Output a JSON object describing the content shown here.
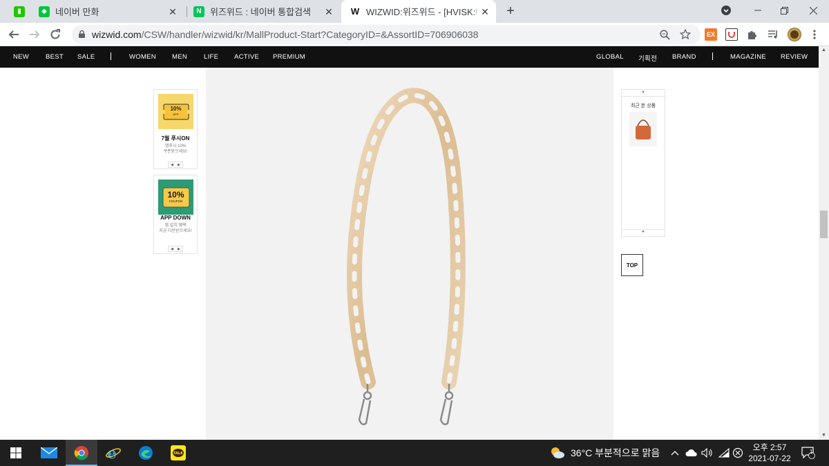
{
  "browser": {
    "tabs": [
      {
        "title": "",
        "favicon": "naver-green-icon",
        "pinned": true
      },
      {
        "title": "네이버 만화",
        "favicon": "naver-webtoon-icon"
      },
      {
        "title": "위즈위드 : 네이버 통합검색",
        "favicon": "naver-n-icon"
      },
      {
        "title": "WIZWID:위즈위드 - [HVISK:비스",
        "favicon": "wizwid-w-icon",
        "active": true
      }
    ],
    "new_tab": "+",
    "url_host": "wizwid.com",
    "url_path": "/CSW/handler/wizwid/kr/MallProduct-Start?CategoryID=&AssortID=706906038",
    "extensions": [
      "EX"
    ]
  },
  "site_nav": {
    "left": [
      "NEW",
      "BEST",
      "SALE",
      "|",
      "WOMEN",
      "MEN",
      "LIFE",
      "ACTIVE",
      "PREMIUM"
    ],
    "right": [
      "GLOBAL",
      "기획전",
      "BRAND",
      "|",
      "MAGAZINE",
      "REVIEW"
    ]
  },
  "promos": [
    {
      "badge_main": "10%",
      "badge_sub": "APP",
      "title": "7월 푸시ON",
      "sub1": "앱푸시 10%",
      "sub2": "쿠폰받으세요!",
      "color": "#f6d76b"
    },
    {
      "badge_main": "10%",
      "badge_sub": "COUPON",
      "title": "APP DOWN",
      "sub1": "앱 설치 혜택",
      "sub2": "지금 다운받으세요!",
      "color": "#2f9a76"
    }
  ],
  "recent": {
    "title": "최근 본 상품"
  },
  "top_button": "TOP",
  "taskbar": {
    "weather": "36°C  부분적으로 맑음",
    "time": "오후 2:57",
    "date": "2021-07-22",
    "notifications": "1"
  }
}
